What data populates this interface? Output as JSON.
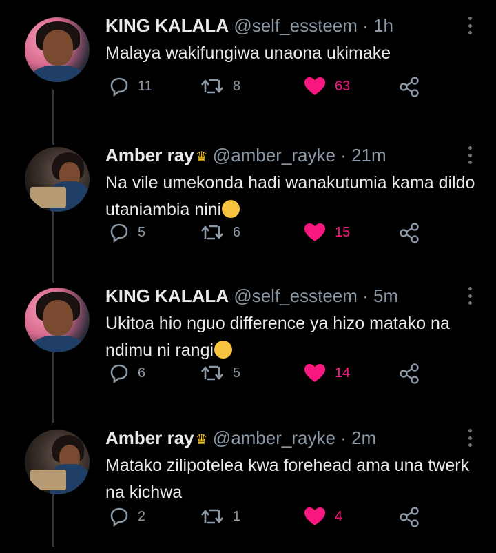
{
  "colors": {
    "background": "#000000",
    "text": "#e7e9ea",
    "muted": "#8b98a5",
    "like": "#f91880",
    "thread_line": "#333639"
  },
  "tweets": [
    {
      "display_name": "KING KALALA",
      "badge_icon": "",
      "handle": "@self_essteem",
      "time": "1h",
      "text": "Malaya wakifungiwa unaona ukimake",
      "emoji": "",
      "replies": "11",
      "retweets": "8",
      "likes": "63",
      "liked": true
    },
    {
      "display_name": "Amber ray",
      "badge_icon": "crown-emoji",
      "handle": "@amber_rayke",
      "time": "21m",
      "text": "Na vile umekonda hadi wanakutumia kama dildo utaniambia nini",
      "emoji": "smirking-face",
      "replies": "5",
      "retweets": "6",
      "likes": "15",
      "liked": true
    },
    {
      "display_name": "KING KALALA",
      "badge_icon": "",
      "handle": "@self_essteem",
      "time": "5m",
      "text": "Ukitoa hio nguo difference ya hizo matako na ndimu ni rangi",
      "emoji": "disappointed-face",
      "replies": "6",
      "retweets": "5",
      "likes": "14",
      "liked": true
    },
    {
      "display_name": "Amber ray",
      "badge_icon": "crown-emoji",
      "handle": "@amber_rayke",
      "time": "2m",
      "text": "Matako zilipotelea kwa forehead ama una twerk na kichwa",
      "emoji": "",
      "replies": "2",
      "retweets": "1",
      "likes": "4",
      "liked": true
    }
  ]
}
